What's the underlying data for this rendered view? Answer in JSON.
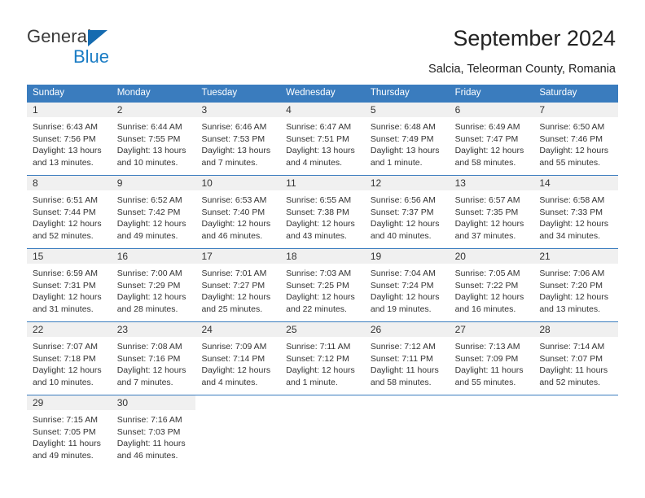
{
  "brand": {
    "name_top": "General",
    "name_bottom": "Blue",
    "color_dark": "#3a3a3a",
    "color_blue": "#1a7cc4"
  },
  "header": {
    "title": "September 2024",
    "subtitle": "Salcia, Teleorman County, Romania"
  },
  "calendar": {
    "accent_color": "#3a7cbe",
    "day_band_color": "#f0f0f0",
    "weekday_headers": [
      "Sunday",
      "Monday",
      "Tuesday",
      "Wednesday",
      "Thursday",
      "Friday",
      "Saturday"
    ],
    "weeks": [
      [
        {
          "day": "1",
          "sunrise": "Sunrise: 6:43 AM",
          "sunset": "Sunset: 7:56 PM",
          "daylight_1": "Daylight: 13 hours",
          "daylight_2": "and 13 minutes."
        },
        {
          "day": "2",
          "sunrise": "Sunrise: 6:44 AM",
          "sunset": "Sunset: 7:55 PM",
          "daylight_1": "Daylight: 13 hours",
          "daylight_2": "and 10 minutes."
        },
        {
          "day": "3",
          "sunrise": "Sunrise: 6:46 AM",
          "sunset": "Sunset: 7:53 PM",
          "daylight_1": "Daylight: 13 hours",
          "daylight_2": "and 7 minutes."
        },
        {
          "day": "4",
          "sunrise": "Sunrise: 6:47 AM",
          "sunset": "Sunset: 7:51 PM",
          "daylight_1": "Daylight: 13 hours",
          "daylight_2": "and 4 minutes."
        },
        {
          "day": "5",
          "sunrise": "Sunrise: 6:48 AM",
          "sunset": "Sunset: 7:49 PM",
          "daylight_1": "Daylight: 13 hours",
          "daylight_2": "and 1 minute."
        },
        {
          "day": "6",
          "sunrise": "Sunrise: 6:49 AM",
          "sunset": "Sunset: 7:47 PM",
          "daylight_1": "Daylight: 12 hours",
          "daylight_2": "and 58 minutes."
        },
        {
          "day": "7",
          "sunrise": "Sunrise: 6:50 AM",
          "sunset": "Sunset: 7:46 PM",
          "daylight_1": "Daylight: 12 hours",
          "daylight_2": "and 55 minutes."
        }
      ],
      [
        {
          "day": "8",
          "sunrise": "Sunrise: 6:51 AM",
          "sunset": "Sunset: 7:44 PM",
          "daylight_1": "Daylight: 12 hours",
          "daylight_2": "and 52 minutes."
        },
        {
          "day": "9",
          "sunrise": "Sunrise: 6:52 AM",
          "sunset": "Sunset: 7:42 PM",
          "daylight_1": "Daylight: 12 hours",
          "daylight_2": "and 49 minutes."
        },
        {
          "day": "10",
          "sunrise": "Sunrise: 6:53 AM",
          "sunset": "Sunset: 7:40 PM",
          "daylight_1": "Daylight: 12 hours",
          "daylight_2": "and 46 minutes."
        },
        {
          "day": "11",
          "sunrise": "Sunrise: 6:55 AM",
          "sunset": "Sunset: 7:38 PM",
          "daylight_1": "Daylight: 12 hours",
          "daylight_2": "and 43 minutes."
        },
        {
          "day": "12",
          "sunrise": "Sunrise: 6:56 AM",
          "sunset": "Sunset: 7:37 PM",
          "daylight_1": "Daylight: 12 hours",
          "daylight_2": "and 40 minutes."
        },
        {
          "day": "13",
          "sunrise": "Sunrise: 6:57 AM",
          "sunset": "Sunset: 7:35 PM",
          "daylight_1": "Daylight: 12 hours",
          "daylight_2": "and 37 minutes."
        },
        {
          "day": "14",
          "sunrise": "Sunrise: 6:58 AM",
          "sunset": "Sunset: 7:33 PM",
          "daylight_1": "Daylight: 12 hours",
          "daylight_2": "and 34 minutes."
        }
      ],
      [
        {
          "day": "15",
          "sunrise": "Sunrise: 6:59 AM",
          "sunset": "Sunset: 7:31 PM",
          "daylight_1": "Daylight: 12 hours",
          "daylight_2": "and 31 minutes."
        },
        {
          "day": "16",
          "sunrise": "Sunrise: 7:00 AM",
          "sunset": "Sunset: 7:29 PM",
          "daylight_1": "Daylight: 12 hours",
          "daylight_2": "and 28 minutes."
        },
        {
          "day": "17",
          "sunrise": "Sunrise: 7:01 AM",
          "sunset": "Sunset: 7:27 PM",
          "daylight_1": "Daylight: 12 hours",
          "daylight_2": "and 25 minutes."
        },
        {
          "day": "18",
          "sunrise": "Sunrise: 7:03 AM",
          "sunset": "Sunset: 7:25 PM",
          "daylight_1": "Daylight: 12 hours",
          "daylight_2": "and 22 minutes."
        },
        {
          "day": "19",
          "sunrise": "Sunrise: 7:04 AM",
          "sunset": "Sunset: 7:24 PM",
          "daylight_1": "Daylight: 12 hours",
          "daylight_2": "and 19 minutes."
        },
        {
          "day": "20",
          "sunrise": "Sunrise: 7:05 AM",
          "sunset": "Sunset: 7:22 PM",
          "daylight_1": "Daylight: 12 hours",
          "daylight_2": "and 16 minutes."
        },
        {
          "day": "21",
          "sunrise": "Sunrise: 7:06 AM",
          "sunset": "Sunset: 7:20 PM",
          "daylight_1": "Daylight: 12 hours",
          "daylight_2": "and 13 minutes."
        }
      ],
      [
        {
          "day": "22",
          "sunrise": "Sunrise: 7:07 AM",
          "sunset": "Sunset: 7:18 PM",
          "daylight_1": "Daylight: 12 hours",
          "daylight_2": "and 10 minutes."
        },
        {
          "day": "23",
          "sunrise": "Sunrise: 7:08 AM",
          "sunset": "Sunset: 7:16 PM",
          "daylight_1": "Daylight: 12 hours",
          "daylight_2": "and 7 minutes."
        },
        {
          "day": "24",
          "sunrise": "Sunrise: 7:09 AM",
          "sunset": "Sunset: 7:14 PM",
          "daylight_1": "Daylight: 12 hours",
          "daylight_2": "and 4 minutes."
        },
        {
          "day": "25",
          "sunrise": "Sunrise: 7:11 AM",
          "sunset": "Sunset: 7:12 PM",
          "daylight_1": "Daylight: 12 hours",
          "daylight_2": "and 1 minute."
        },
        {
          "day": "26",
          "sunrise": "Sunrise: 7:12 AM",
          "sunset": "Sunset: 7:11 PM",
          "daylight_1": "Daylight: 11 hours",
          "daylight_2": "and 58 minutes."
        },
        {
          "day": "27",
          "sunrise": "Sunrise: 7:13 AM",
          "sunset": "Sunset: 7:09 PM",
          "daylight_1": "Daylight: 11 hours",
          "daylight_2": "and 55 minutes."
        },
        {
          "day": "28",
          "sunrise": "Sunrise: 7:14 AM",
          "sunset": "Sunset: 7:07 PM",
          "daylight_1": "Daylight: 11 hours",
          "daylight_2": "and 52 minutes."
        }
      ],
      [
        {
          "day": "29",
          "sunrise": "Sunrise: 7:15 AM",
          "sunset": "Sunset: 7:05 PM",
          "daylight_1": "Daylight: 11 hours",
          "daylight_2": "and 49 minutes."
        },
        {
          "day": "30",
          "sunrise": "Sunrise: 7:16 AM",
          "sunset": "Sunset: 7:03 PM",
          "daylight_1": "Daylight: 11 hours",
          "daylight_2": "and 46 minutes."
        },
        {
          "day": "",
          "sunrise": "",
          "sunset": "",
          "daylight_1": "",
          "daylight_2": ""
        },
        {
          "day": "",
          "sunrise": "",
          "sunset": "",
          "daylight_1": "",
          "daylight_2": ""
        },
        {
          "day": "",
          "sunrise": "",
          "sunset": "",
          "daylight_1": "",
          "daylight_2": ""
        },
        {
          "day": "",
          "sunrise": "",
          "sunset": "",
          "daylight_1": "",
          "daylight_2": ""
        },
        {
          "day": "",
          "sunrise": "",
          "sunset": "",
          "daylight_1": "",
          "daylight_2": ""
        }
      ]
    ]
  }
}
